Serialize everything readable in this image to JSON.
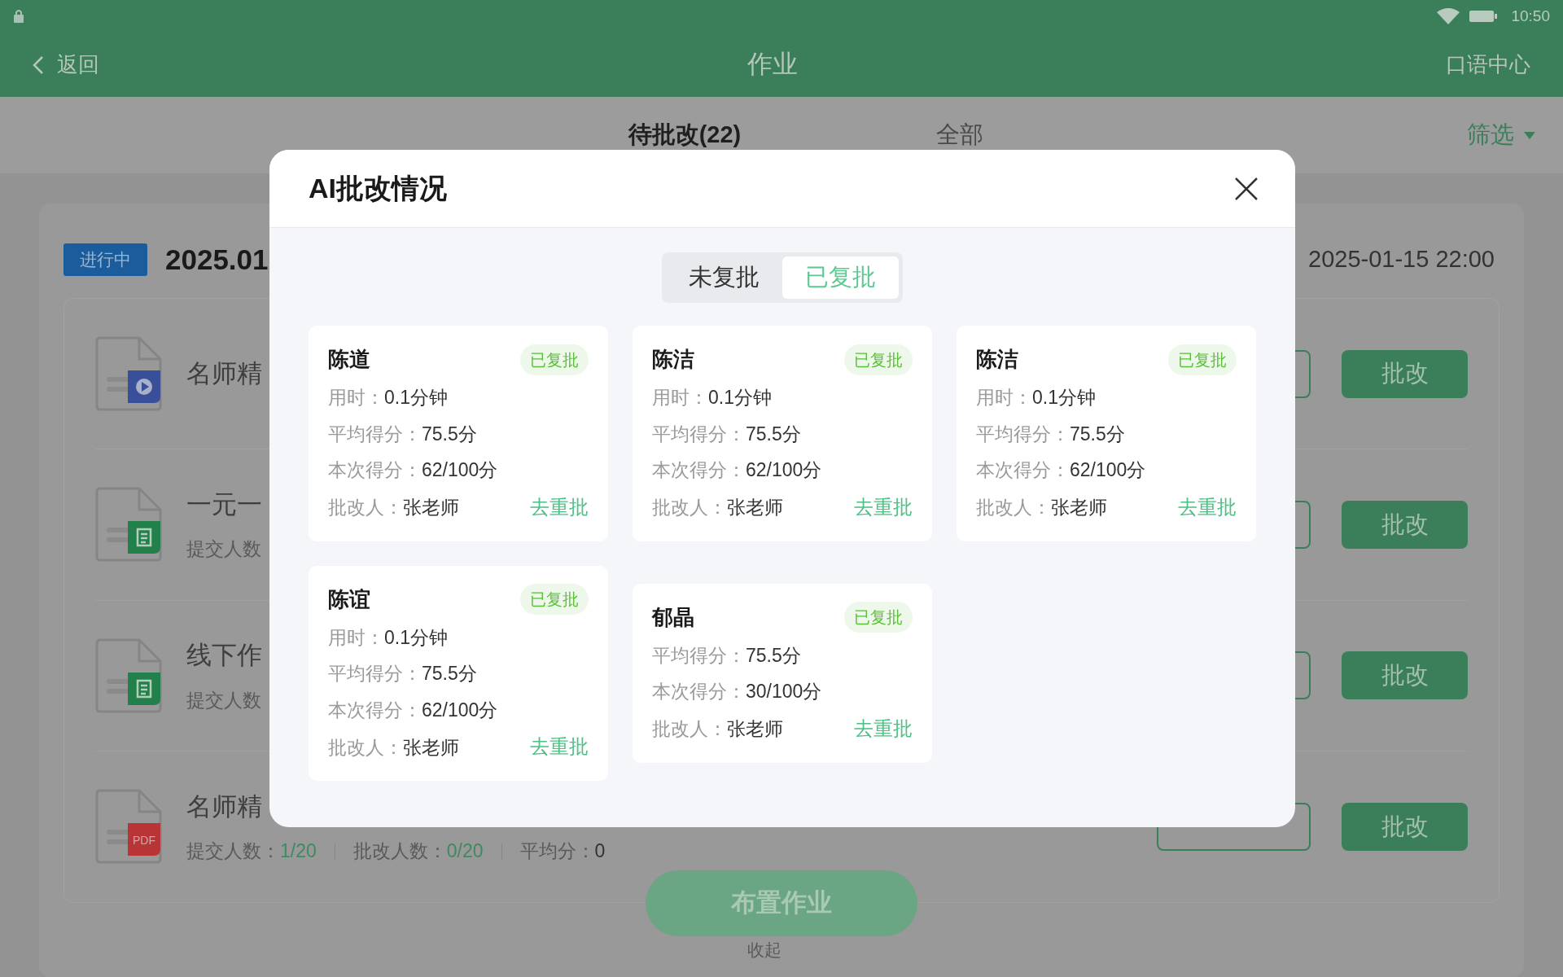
{
  "status_bar": {
    "time": "10:50"
  },
  "nav": {
    "back": "返回",
    "title": "作业",
    "right": "口语中心"
  },
  "tabs": [
    {
      "label": "待批改(22)",
      "selected": true
    },
    {
      "label": "全部",
      "selected": false
    }
  ],
  "filter": "筛选",
  "group": {
    "status": "进行中",
    "date_start": "2025.01",
    "date_end": "2025-01-15 22:00"
  },
  "assignments": [
    {
      "kind": "video",
      "title": "名师精",
      "action": "批改"
    },
    {
      "kind": "doc",
      "title": "一元一",
      "stats": [
        {
          "label": "提交人数"
        }
      ],
      "action": "批改"
    },
    {
      "kind": "doc",
      "title": "线下作",
      "stats": [
        {
          "label": "提交人数"
        }
      ],
      "action": "批改"
    },
    {
      "kind": "pdf",
      "badge": "PDF",
      "title": "名师精",
      "stats": [
        {
          "label": "提交人数：",
          "value": "1/20",
          "green": true
        },
        {
          "label": "批改人数：",
          "value": "0/20",
          "green": true
        },
        {
          "label": "平均分：",
          "value": "0",
          "green": false
        }
      ],
      "action": "批改"
    }
  ],
  "fab": "布置作业",
  "collapse": "收起",
  "dialog": {
    "title": "AI批改情况",
    "segments": [
      {
        "label": "未复批",
        "selected": false
      },
      {
        "label": "已复批",
        "selected": true
      }
    ],
    "cards": [
      {
        "name": "陈道",
        "badge": "已复批",
        "fields": [
          {
            "label": "用时：",
            "value": "0.1分钟"
          },
          {
            "label": "平均得分：",
            "value": "75.5分"
          },
          {
            "label": "本次得分：",
            "value": "62/100分"
          },
          {
            "label": "批改人：",
            "value": "张老师"
          }
        ],
        "action": "去重批"
      },
      {
        "name": "陈洁",
        "badge": "已复批",
        "fields": [
          {
            "label": "用时：",
            "value": "0.1分钟"
          },
          {
            "label": "平均得分：",
            "value": "75.5分"
          },
          {
            "label": "本次得分：",
            "value": "62/100分"
          },
          {
            "label": "批改人：",
            "value": "张老师"
          }
        ],
        "action": "去重批"
      },
      {
        "name": "陈洁",
        "badge": "已复批",
        "fields": [
          {
            "label": "用时：",
            "value": "0.1分钟"
          },
          {
            "label": "平均得分：",
            "value": "75.5分"
          },
          {
            "label": "本次得分：",
            "value": "62/100分"
          },
          {
            "label": "批改人：",
            "value": "张老师"
          }
        ],
        "action": "去重批"
      },
      {
        "name": "陈谊",
        "badge": "已复批",
        "fields": [
          {
            "label": "用时：",
            "value": "0.1分钟"
          },
          {
            "label": "平均得分：",
            "value": "75.5分"
          },
          {
            "label": "本次得分：",
            "value": "62/100分"
          },
          {
            "label": "批改人：",
            "value": "张老师"
          }
        ],
        "action": "去重批"
      },
      {
        "name": "郁晶",
        "badge": "已复批",
        "fields": [
          {
            "label": "平均得分：",
            "value": "75.5分"
          },
          {
            "label": "本次得分：",
            "value": "30/100分"
          },
          {
            "label": "批改人：",
            "value": "张老师"
          }
        ],
        "action": "去重批"
      }
    ]
  }
}
